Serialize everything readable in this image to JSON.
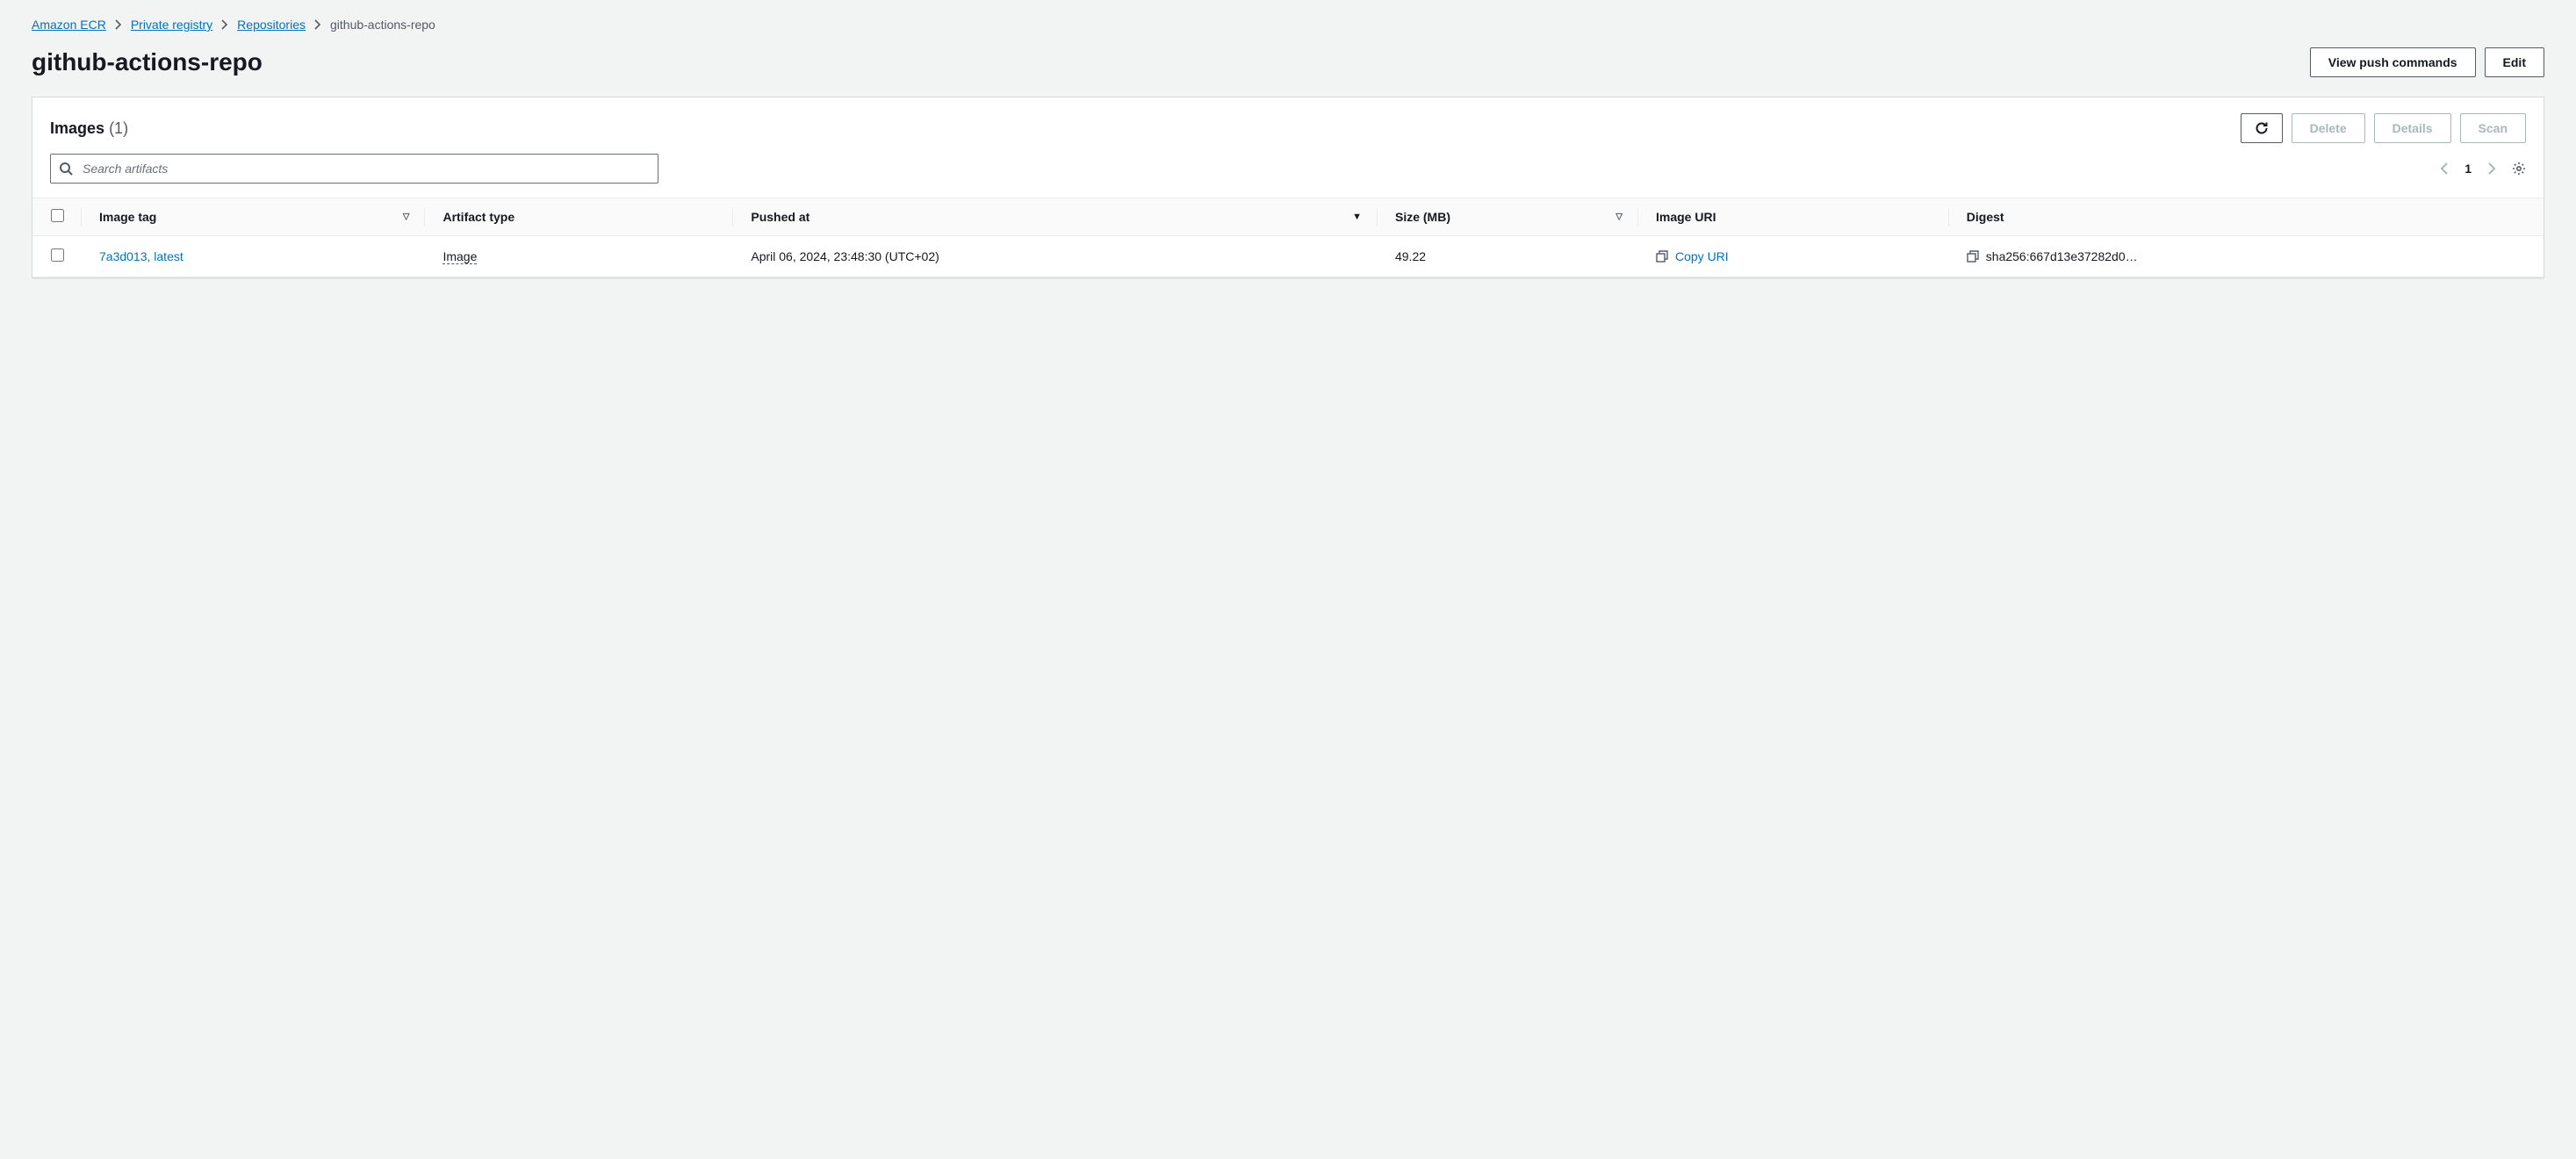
{
  "breadcrumb": {
    "items": [
      "Amazon ECR",
      "Private registry",
      "Repositories"
    ],
    "current": "github-actions-repo"
  },
  "page": {
    "title": "github-actions-repo"
  },
  "header_buttons": {
    "view_push": "View push commands",
    "edit": "Edit"
  },
  "panel": {
    "title": "Images",
    "count": "(1)",
    "actions": {
      "delete": "Delete",
      "details": "Details",
      "scan": "Scan"
    }
  },
  "search": {
    "placeholder": "Search artifacts"
  },
  "pagination": {
    "page": "1"
  },
  "table": {
    "headers": {
      "image_tag": "Image tag",
      "artifact_type": "Artifact type",
      "pushed_at": "Pushed at",
      "size": "Size (MB)",
      "image_uri": "Image URI",
      "digest": "Digest"
    },
    "rows": [
      {
        "image_tag": "7a3d013, latest",
        "artifact_type": "Image",
        "pushed_at": "April 06, 2024, 23:48:30 (UTC+02)",
        "size": "49.22",
        "image_uri_label": "Copy URI",
        "digest": "sha256:667d13e37282d0…"
      }
    ]
  }
}
